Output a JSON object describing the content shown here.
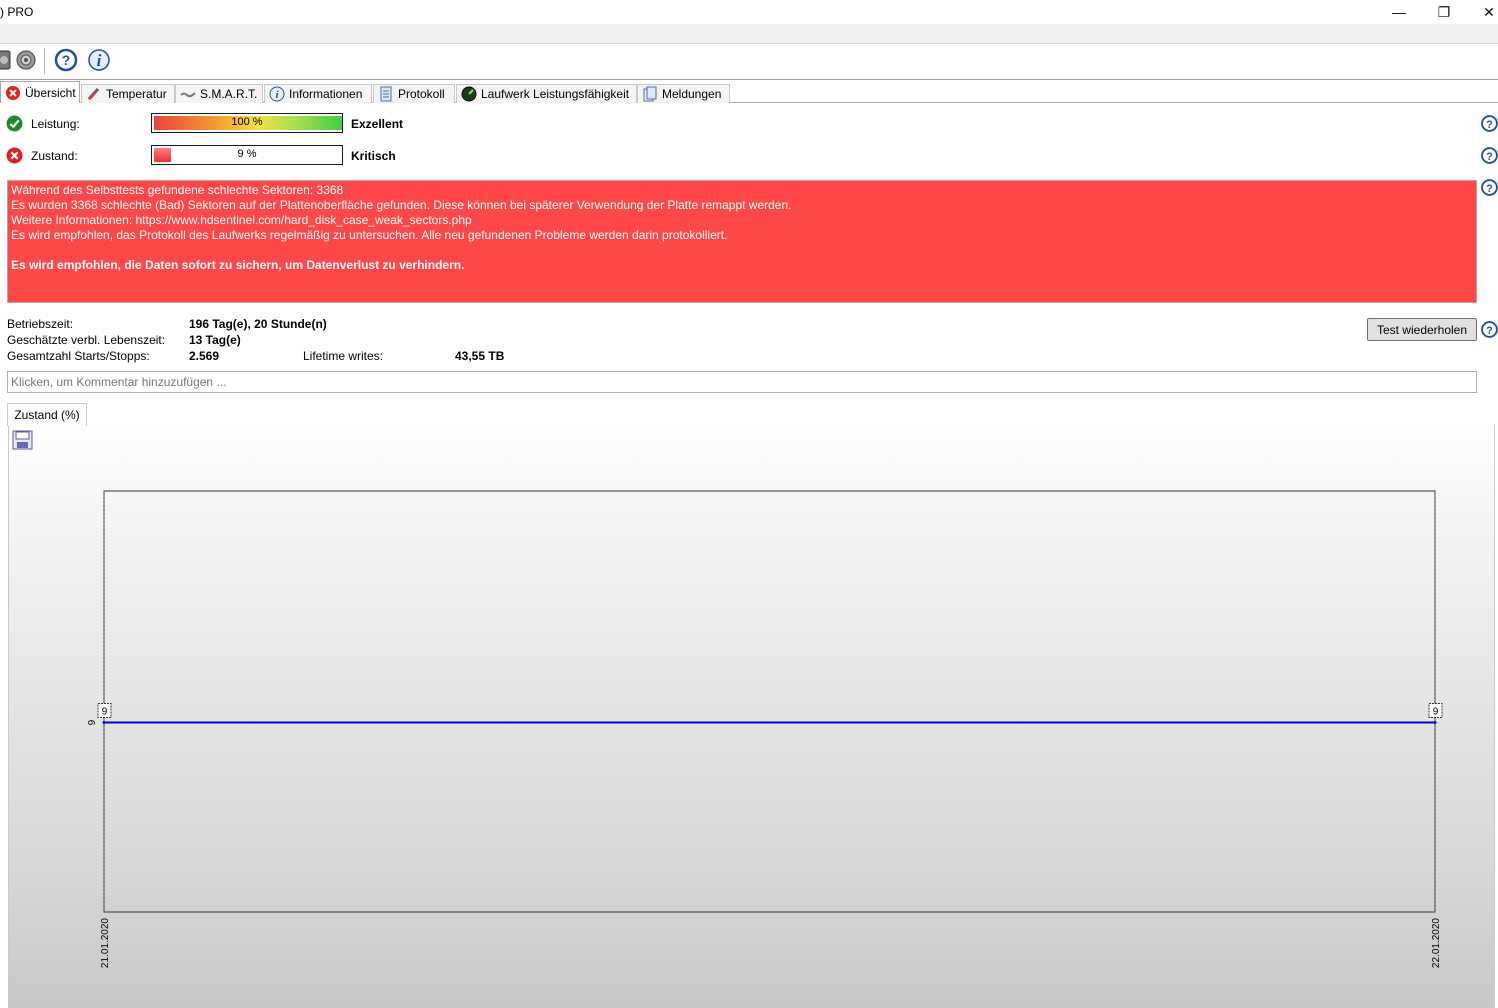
{
  "window": {
    "title": ") PRO",
    "minimize_glyph": "—",
    "restore_glyph": "❐",
    "close_glyph": "✕"
  },
  "toolbar": {
    "icons": [
      "disk-icon",
      "speaker-icon",
      "help-icon",
      "info-icon"
    ]
  },
  "tabs": [
    {
      "label": "Übersicht",
      "icon": "error-icon",
      "active": true
    },
    {
      "label": "Temperatur",
      "icon": "thermometer-icon"
    },
    {
      "label": "S.M.A.R.T.",
      "icon": "smart-icon"
    },
    {
      "label": "Informationen",
      "icon": "info-icon"
    },
    {
      "label": "Protokoll",
      "icon": "document-icon"
    },
    {
      "label": "Laufwerk Leistungsfähigkeit",
      "icon": "gauge-icon"
    },
    {
      "label": "Meldungen",
      "icon": "messages-icon"
    }
  ],
  "performance": {
    "label": "Leistung:",
    "value_text": "100 %",
    "value": 100,
    "status": "Exzellent"
  },
  "health": {
    "label": "Zustand:",
    "value_text": "9 %",
    "value": 9,
    "status": "Kritisch"
  },
  "alert": {
    "lines": [
      "Während des Selbsttests gefundene schlechte Sektoren: 3368",
      "Es wurden 3368 schlechte (Bad) Sektoren auf der Plattenoberfläche gefunden. Diese können bei späterer Verwendung der Platte remappt werden.",
      "Weitere Informationen: https://www.hdsentinel.com/hard_disk_case_weak_sectors.php",
      "Es wird empfohlen, das Protokoll des Laufwerks regelmäßig zu untersuchen. Alle neu gefundenen Probleme werden darin protokolliert."
    ],
    "bold_line": "Es wird empfohlen, die Daten sofort zu sichern, um Datenverlust zu verhindern."
  },
  "info": {
    "uptime_label": "Betriebszeit:",
    "uptime_value": "196 Tag(e), 20 Stunde(n)",
    "remaining_label": "Geschätzte verbl. Lebenszeit:",
    "remaining_value": "13 Tag(e)",
    "starts_label": "Gesamtzahl Starts/Stopps:",
    "starts_value": "2.569",
    "writes_label": "Lifetime writes:",
    "writes_value": "43,55 TB"
  },
  "test_button": "Test wiederholen",
  "comment_placeholder": "Klicken, um Kommentar hinzuzufügen ...",
  "chart_tab": "Zustand (%)",
  "chart_data": {
    "type": "line",
    "x": [
      "21.01.2020",
      "22.01.2020"
    ],
    "series": [
      {
        "values": [
          9,
          9
        ]
      }
    ],
    "data_labels": [
      "9",
      "9"
    ],
    "y_tick_labels": [
      "9"
    ],
    "line_color": "#0000cc",
    "grid": false
  }
}
